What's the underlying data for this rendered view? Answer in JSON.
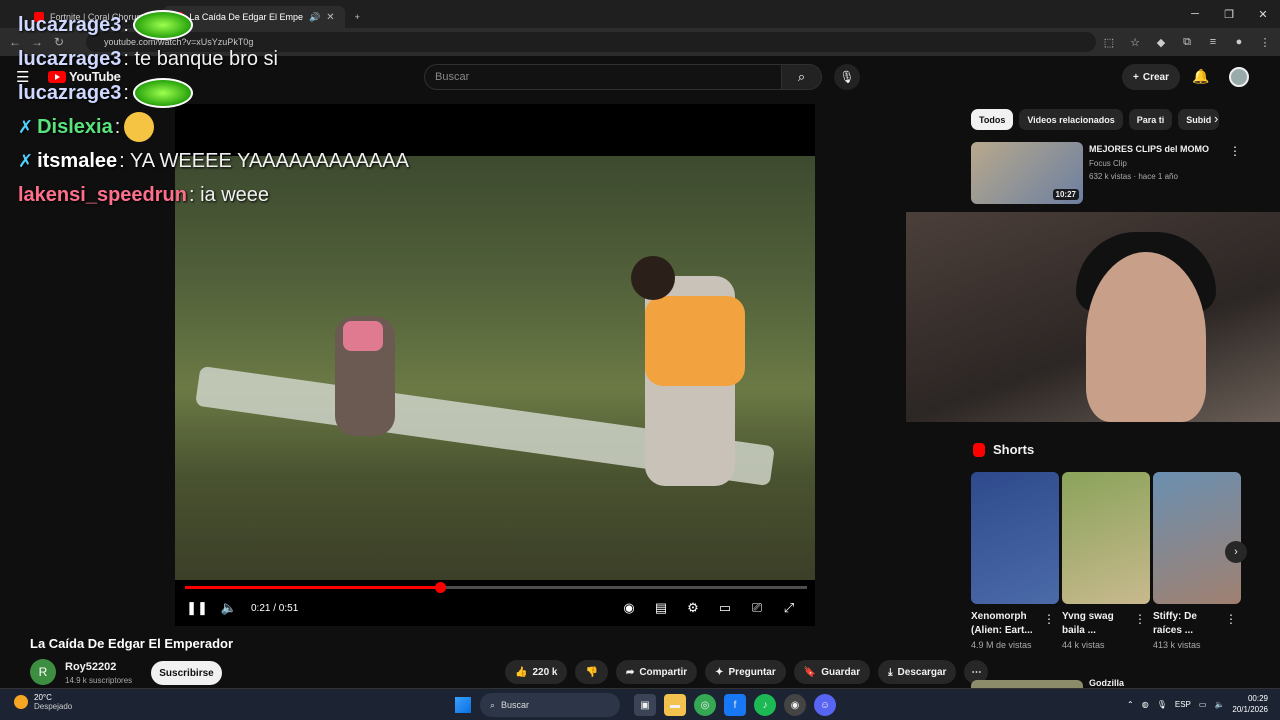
{
  "browser": {
    "tabs": [
      {
        "label": "Fortnite | Coral Chorus Lo",
        "active": false
      },
      {
        "label": "La Caída De Edgar El Empe",
        "active": true
      }
    ],
    "new_tab": "+",
    "url": "youtube.com/watch?v=xUsYzuPkT0g"
  },
  "header": {
    "logo": "YouTube",
    "search_placeholder": "Buscar",
    "create_label": "Crear"
  },
  "chat": [
    {
      "user": "lucazrage3",
      "user_color": "#cfd8ff",
      "message": "",
      "emote": true,
      "badge": false
    },
    {
      "user": "lucazrage3",
      "user_color": "#cfd8ff",
      "message": ": te banque bro si",
      "emote": false,
      "badge": false
    },
    {
      "user": "lucazrage3",
      "user_color": "#cfd8ff",
      "message": "",
      "emote": true,
      "badge": false
    },
    {
      "user": "Dislexia",
      "user_color": "#59e37c",
      "message": "",
      "emote_face": true,
      "badge": true
    },
    {
      "user": "itsmalee",
      "user_color": "#ffffff",
      "message": ": YA WEEEE YAAAAAAAAAAAA",
      "badge": true
    },
    {
      "user": "lakensi_speedrun",
      "user_color": "#ff6f8c",
      "message": ": ia weee",
      "badge": false
    }
  ],
  "player": {
    "current_time": "0:21",
    "duration": "0:51",
    "time_display": "0:21 / 0:51",
    "progress": 0.41
  },
  "video": {
    "title": "La Caída De Edgar El Emperador",
    "channel": "Roy52202",
    "channel_initial": "R",
    "subscribers": "14.9 k suscriptores",
    "subscribe_label": "Suscribirse",
    "likes": "220 k",
    "share_label": "Compartir",
    "ask_label": "Preguntar",
    "save_label": "Guardar",
    "download_label": "Descargar"
  },
  "sidebar": {
    "chips": [
      "Todos",
      "Videos relacionados",
      "Para ti",
      "Subid"
    ],
    "rec1": {
      "title": "MEJORES CLIPS del MOMO",
      "channel": "Focus Clip",
      "meta": "632 k vistas · hace 1 año",
      "duration": "10:27"
    },
    "shorts_heading": "Shorts",
    "shorts": [
      {
        "title": "Xenomorph (Alien: Eart...",
        "views": "4.9 M de vistas",
        "color": "#2e4a8c"
      },
      {
        "title": "Yvng swag baila ...",
        "views": "44 k vistas",
        "color": "#8aa35a"
      },
      {
        "title": "Stiffy: De raíces ...",
        "views": "413 k vistas",
        "color": "#6a8fb0"
      }
    ],
    "rec2": {
      "title": "Godzilla"
    }
  },
  "taskbar": {
    "temperature": "20°C",
    "weather": "Despejado",
    "search_label": "Buscar",
    "language": "ESP",
    "time": "00:29",
    "date": "20/1/2026"
  }
}
